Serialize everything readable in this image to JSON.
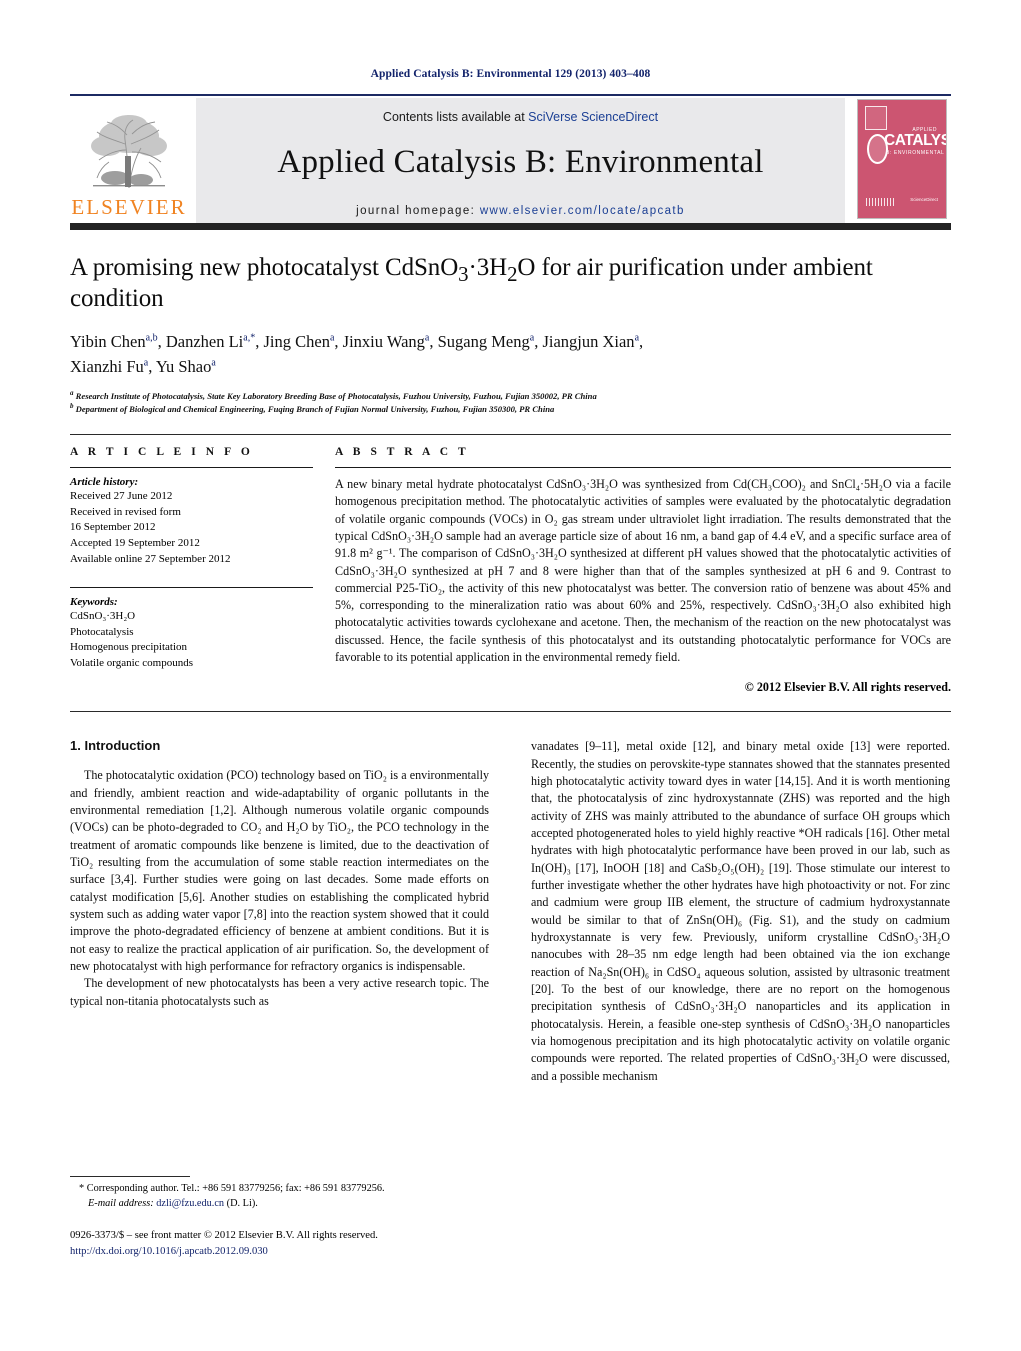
{
  "running_head": "Applied Catalysis B: Environmental 129 (2013) 403–408",
  "masthead": {
    "contents_prefix": "Contents lists available at ",
    "contents_link": "SciVerse ScienceDirect",
    "journal_name": "Applied Catalysis B: Environmental",
    "homepage_prefix": "journal homepage: ",
    "homepage_url": "www.elsevier.com/locate/apcatb",
    "publisher_wordmark": "ELSEVIER",
    "publisher_color": "#f08321",
    "cover": {
      "applied_label": "APPLIED",
      "title": "CATALYSIS",
      "subtitle": "B: ENVIRONMENTAL",
      "sciencedirect_label": "Available online at",
      "sciencedirect_name": "ScienceDirect",
      "color": "#cc5571"
    }
  },
  "article": {
    "title": "A promising new photocatalyst CdSnO₃·3H₂O for air purification under ambient condition",
    "authors_line1": "Yibin Chen",
    "authors_html": "Yibin Chen<sup>a,b</sup>, Danzhen Li<sup>a,*</sup>, Jing Chen<sup>a</sup>, Jinxiu Wang<sup>a</sup>, Sugang Meng<sup>a</sup>, Jiangjun Xian<sup>a</sup>, Xianzhi Fu<sup>a</sup>, Yu Shao<sup>a</sup>",
    "affiliation_a": "Research Institute of Photocatalysis, State Key Laboratory Breeding Base of Photocatalysis, Fuzhou University, Fuzhou, Fujian 350002, PR China",
    "affiliation_b": "Department of Biological and Chemical Engineering, Fuqing Branch of Fujian Normal University, Fuzhou, Fujian 350300, PR China"
  },
  "article_info": {
    "label": "A R T I C L E    I N F O",
    "history_head": "Article history:",
    "history": [
      "Received 27 June 2012",
      "Received in revised form",
      "16 September 2012",
      "Accepted 19 September 2012",
      "Available online 27 September 2012"
    ],
    "keywords_head": "Keywords:",
    "keywords": [
      "CdSnO₃·3H₂O",
      "Photocatalysis",
      "Homogenous precipitation",
      "Volatile organic compounds"
    ]
  },
  "abstract": {
    "label": "A B S T R A C T",
    "text": "A new binary metal hydrate photocatalyst CdSnO₃·3H₂O was synthesized from Cd(CH₃COO)₂ and SnCl₄·5H₂O via a facile homogenous precipitation method. The photocatalytic activities of samples were evaluated by the photocatalytic degradation of volatile organic compounds (VOCs) in O₂ gas stream under ultraviolet light irradiation. The results demonstrated that the typical CdSnO₃·3H₂O sample had an average particle size of about 16 nm, a band gap of 4.4 eV, and a specific surface area of 91.8 m² g⁻¹. The comparison of CdSnO₃·3H₂O synthesized at different pH values showed that the photocatalytic activities of CdSnO₃·3H₂O synthesized at pH 7 and 8 were higher than that of the samples synthesized at pH 6 and 9. Contrast to commercial P25-TiO₂, the activity of this new photocatalyst was better. The conversion ratio of benzene was about 45% and 5%, corresponding to the mineralization ratio was about 60% and 25%, respectively. CdSnO₃·3H₂O also exhibited high photocatalytic activities towards cyclohexane and acetone. Then, the mechanism of the reaction on the new photocatalyst was discussed. Hence, the facile synthesis of this photocatalyst and its outstanding photocatalytic performance for VOCs are favorable to its potential application in the environmental remedy field.",
    "copyright": "© 2012 Elsevier B.V. All rights reserved."
  },
  "sections": {
    "intro_heading": "1.  Introduction",
    "left_paragraphs": [
      "The photocatalytic oxidation (PCO) technology based on TiO₂ is a environmentally and friendly, ambient reaction and wide-adaptability of organic pollutants in the environmental remediation [1,2]. Although numerous volatile organic compounds (VOCs) can be photo-degraded to CO₂ and H₂O by TiO₂, the PCO technology in the treatment of aromatic compounds like benzene is limited, due to the deactivation of TiO₂ resulting from the accumulation of some stable reaction intermediates on the surface [3,4]. Further studies were going on last decades. Some made efforts on catalyst modification [5,6]. Another studies on establishing the complicated hybrid system such as adding water vapor [7,8] into the reaction system showed that it could improve the photo-degradated efficiency of benzene at ambient conditions. But it is not easy to realize the practical application of air purification. So, the development of new photocatalyst with high performance for refractory organics is indispensable.",
      "The development of new photocatalysts has been a very active research topic. The typical non-titania photocatalysts such as"
    ],
    "right_paragraphs": [
      "vanadates [9–11], metal oxide [12], and binary metal oxide [13] were reported. Recently, the studies on perovskite-type stannates showed that the stannates presented high photocatalytic activity toward dyes in water [14,15]. And it is worth mentioning that, the photocatalysis of zinc hydroxystannate (ZHS) was reported and the high activity of ZHS was mainly attributed to the abundance of surface OH groups which accepted photogenerated holes to yield highly reactive *OH radicals [16]. Other metal hydrates with high photocatalytic performance have been proved in our lab, such as In(OH)₃ [17], InOOH [18] and CaSb₂O₅(OH)₂ [19]. Those stimulate our interest to further investigate whether the other hydrates have high photoactivity or not. For zinc and cadmium were group IIB element, the structure of cadmium hydroxystannate would be similar to that of ZnSn(OH)₆ (Fig. S1), and the study on cadmium hydroxystannate is very few. Previously, uniform crystalline CdSnO₃·3H₂O nanocubes with 28–35 nm edge length had been obtained via the ion exchange reaction of Na₂Sn(OH)₆ in CdSO₄ aqueous solution, assisted by ultrasonic treatment [20]. To the best of our knowledge, there are no report on the homogenous precipitation synthesis of CdSnO₃·3H₂O nanoparticles and its application in photocatalysis. Herein, a feasible one-step synthesis of CdSnO₃·3H₂O nanoparticles via homogenous precipitation and its high photocatalytic activity on volatile organic compounds were reported. The related properties of CdSnO₃·3H₂O were discussed, and a possible mechanism"
    ]
  },
  "footnote": {
    "marker": "*",
    "text": "Corresponding author. Tel.: +86 591 83779256; fax: +86 591 83779256.",
    "email_label": "E-mail address:",
    "email": "dzli@fzu.edu.cn",
    "email_owner": "(D. Li)."
  },
  "footer": {
    "front_matter": "0926-3373/$ – see front matter © 2012 Elsevier B.V. All rights reserved.",
    "doi": "http://dx.doi.org/10.1016/j.apcatb.2012.09.030"
  }
}
